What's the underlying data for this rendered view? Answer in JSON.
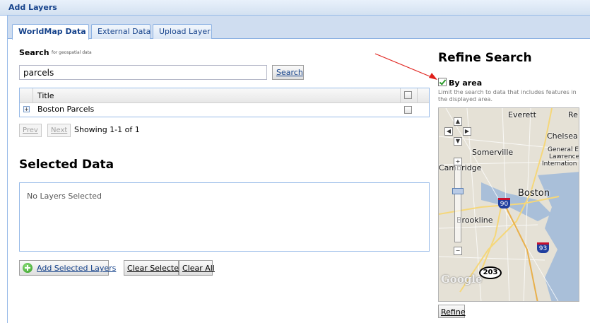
{
  "window": {
    "title": "Add Layers"
  },
  "tabs": [
    {
      "label": "WorldMap Data",
      "active": true
    },
    {
      "label": "External Data",
      "active": false
    },
    {
      "label": "Upload Layer",
      "active": false
    }
  ],
  "search": {
    "label": "Search",
    "hint": "for geospatial data",
    "value": "parcels",
    "button_label": "Search"
  },
  "results": {
    "columns": [
      "Title"
    ],
    "rows": [
      {
        "title": "Boston Parcels",
        "checked": false
      }
    ],
    "prev_label": "Prev",
    "next_label": "Next",
    "status": "Showing 1-1 of 1"
  },
  "selected": {
    "title": "Selected Data",
    "empty_text": "No Layers Selected",
    "add_button": "Add Selected Layers",
    "clear_selected_button": "Clear Selected",
    "clear_all_button": "Clear All"
  },
  "refine": {
    "title": "Refine Search",
    "by_area_label": "By area",
    "by_area_checked": true,
    "by_area_hint": "Limit the search to data that includes features in the displayed area.",
    "button_label": "Refine",
    "map": {
      "labels": [
        "Everett",
        "Re",
        "Chelsea",
        "General E",
        "Lawrence",
        "Internation",
        "Somerville",
        "Cambridge",
        "Boston",
        "Brookline"
      ],
      "shields": [
        "90",
        "93",
        "203"
      ],
      "attribution": "Google"
    }
  },
  "colors": {
    "accent": "#15428b",
    "border": "#99bbe8",
    "annotation_arrow": "#e0201b"
  }
}
